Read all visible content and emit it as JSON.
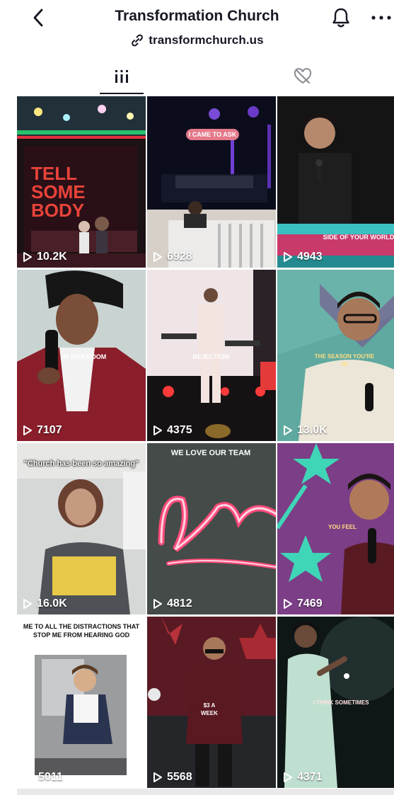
{
  "header": {
    "title": "Transformation Church",
    "link": "transformchurch.us"
  },
  "tabs": [
    {
      "name": "videos",
      "icon": "grid-icon",
      "active": true
    },
    {
      "name": "liked",
      "icon": "liked-hidden-icon",
      "active": false
    }
  ],
  "videos": [
    {
      "views": "10.2K",
      "caption": "TELL SOME BODY"
    },
    {
      "views": "6928",
      "caption": "I CAME TO ASK"
    },
    {
      "views": "4943",
      "caption": "SIDE OF YOUR WORLD"
    },
    {
      "views": "7107",
      "caption": "IN THIS ROOM"
    },
    {
      "views": "4375",
      "caption": "REJECTION"
    },
    {
      "views": "13.0K",
      "caption": "THE SEASON YOU'RE IN"
    },
    {
      "views": "16.0K",
      "caption": "\"Church has been so amazing\""
    },
    {
      "views": "4812",
      "caption": "WE LOVE OUR TEAM"
    },
    {
      "views": "7469",
      "caption": "YOU FEEL"
    },
    {
      "views": "5011",
      "caption": "ME TO ALL THE DISTRACTIONS THAT STOP ME FROM HEARING GOD"
    },
    {
      "views": "5568",
      "caption": "$3 A WEEK"
    },
    {
      "views": "4371",
      "caption": "I THINK SOMETIMES"
    }
  ],
  "colors": {
    "text": "#161823",
    "inactive": "#8a8b91",
    "accent_pink": "#fe2c55"
  }
}
